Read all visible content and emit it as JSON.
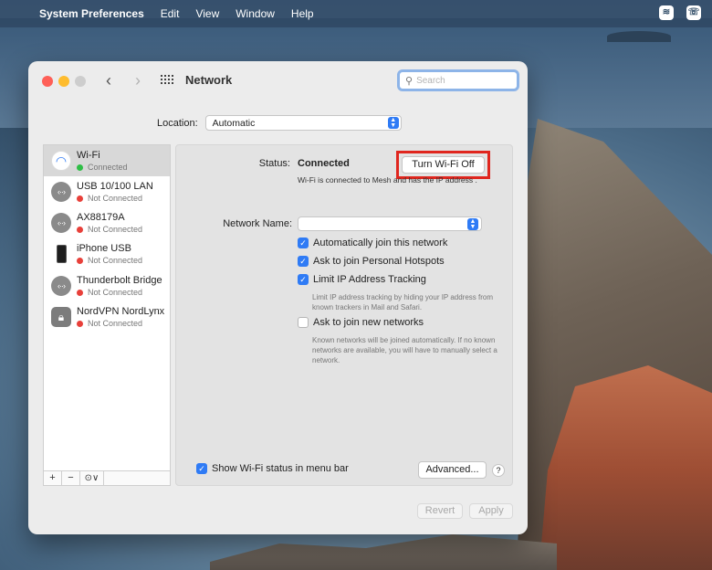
{
  "menubar": {
    "app_name": "System Preferences",
    "items": [
      "Edit",
      "View",
      "Window",
      "Help"
    ]
  },
  "window": {
    "title": "Network",
    "search_placeholder": "Search"
  },
  "location": {
    "label": "Location:",
    "value": "Automatic"
  },
  "services": [
    {
      "name": "Wi-Fi",
      "status": "Connected",
      "status_color": "#2fbe46",
      "icon": "wifi-icon",
      "selected": true
    },
    {
      "name": "USB 10/100 LAN",
      "status": "Not Connected",
      "status_color": "#e8403a",
      "icon": "ethernet-icon",
      "selected": false
    },
    {
      "name": "AX88179A",
      "status": "Not Connected",
      "status_color": "#e8403a",
      "icon": "ethernet-icon",
      "selected": false
    },
    {
      "name": "iPhone USB",
      "status": "Not Connected",
      "status_color": "#e8403a",
      "icon": "iphone-icon",
      "selected": false
    },
    {
      "name": "Thunderbolt Bridge",
      "status": "Not Connected",
      "status_color": "#e8403a",
      "icon": "ethernet-icon",
      "selected": false
    },
    {
      "name": "NordVPN NordLynx",
      "status": "Not Connected",
      "status_color": "#e8403a",
      "icon": "lock-icon",
      "selected": false
    }
  ],
  "sidebar_controls": {
    "add": "+",
    "remove": "−",
    "action": "⊙∨"
  },
  "detail": {
    "status_label": "Status:",
    "status_value": "Connected",
    "turn_off_button": "Turn Wi-Fi Off",
    "status_description": "Wi-Fi is connected to Mesh and has the IP address .",
    "network_name_label": "Network Name:",
    "network_name_value": "",
    "options": [
      {
        "label": "Automatically join this network",
        "checked": true
      },
      {
        "label": "Ask to join Personal Hotspots",
        "checked": true
      },
      {
        "label": "Limit IP Address Tracking",
        "checked": true
      },
      {
        "label": "Ask to join new networks",
        "checked": false
      }
    ],
    "limit_ip_note": "Limit IP address tracking by hiding your IP address from known trackers in Mail and Safari.",
    "ask_join_note": "Known networks will be joined automatically. If no known networks are available, you will have to manually select a network.",
    "show_wifi_status": "Show Wi-Fi status in menu bar",
    "show_wifi_checked": true,
    "advanced_button": "Advanced...",
    "help_button": "?"
  },
  "footer": {
    "revert": "Revert",
    "apply": "Apply"
  },
  "colors": {
    "accent": "#2f7bf5",
    "highlight_box": "#e0261e"
  }
}
